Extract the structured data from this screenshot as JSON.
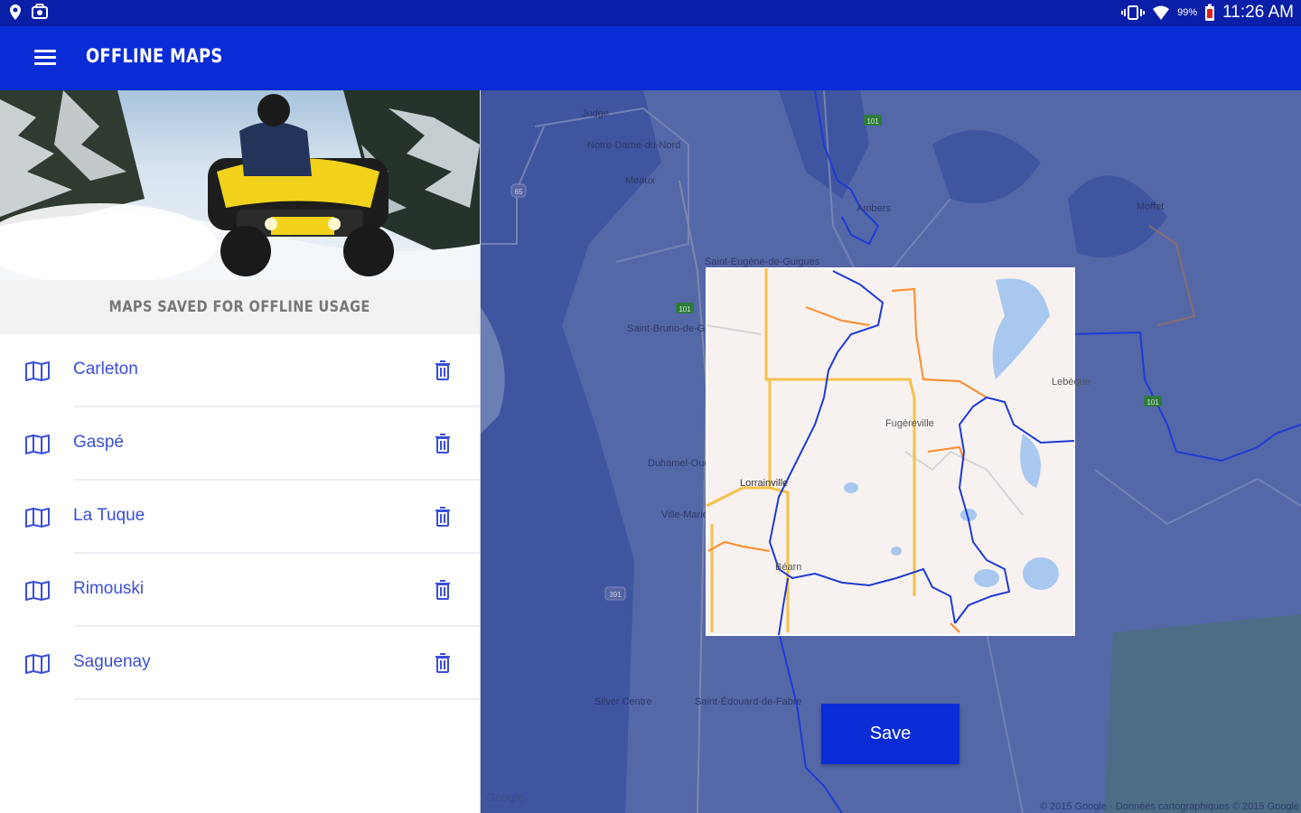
{
  "status_bar": {
    "battery": "99%",
    "time": "11:26 AM"
  },
  "app_bar": {
    "title": "OFFLINE MAPS"
  },
  "sidebar": {
    "section_title": "MAPS SAVED FOR OFFLINE USAGE",
    "maps": [
      {
        "name": "Carleton"
      },
      {
        "name": "Gaspé"
      },
      {
        "name": "La Tuque"
      },
      {
        "name": "Rimouski"
      },
      {
        "name": "Saguenay"
      }
    ]
  },
  "map": {
    "place_labels": {
      "judge": "Judge",
      "notre_dame": "Notre-Dame-du-Nord",
      "meaux": "Meaux",
      "ambers": "Ambers",
      "moffet": "Moffet",
      "saint_eugene": "Saint-Eugène-de-Guigues",
      "saint_bruno": "Saint-Bruno-de-Guigues",
      "lebeque": "Lebèque",
      "fugereville": "Fugèreville",
      "duhamel": "Duhamel-Ouest",
      "lorrainville": "Lorrainville",
      "ville_marie": "Ville-Marie",
      "beary": "Béarn",
      "silver_centre": "Silver Centre",
      "saint_edouard": "Saint-Édouard-de-Fabre"
    },
    "road_shields": [
      "101",
      "65",
      "101",
      "101",
      "391"
    ],
    "save_label": "Save",
    "google_logo": "Google",
    "attribution": "© 2015 Google · Données cartographiques © 2015 Google"
  },
  "colors": {
    "status_bar": "#0a1fa8",
    "app_bar": "#0a2cd6",
    "accent": "#3a4ed8",
    "route": "#1f3ad6",
    "map_overlay": "#5468a8"
  }
}
